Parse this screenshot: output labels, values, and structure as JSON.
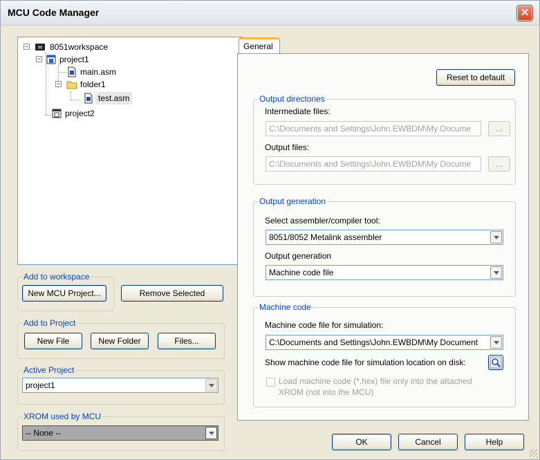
{
  "window": {
    "title": "MCU Code Manager",
    "close_icon": "close-icon"
  },
  "tree": {
    "root": "8051workspace",
    "project1": "project1",
    "main_asm": "main.asm",
    "folder1": "folder1",
    "test_asm": "test.asm",
    "project2": "project2",
    "expand_minus": "−"
  },
  "add_to_workspace": {
    "legend": "Add to workspace",
    "new_mcu_project": "New MCU Project...",
    "remove_selected": "Remove Selected"
  },
  "add_to_project": {
    "legend": "Add to Project",
    "new_file": "New File",
    "new_folder": "New Folder",
    "files": "Files..."
  },
  "active_project": {
    "legend": "Active Project",
    "value": "project1"
  },
  "xrom": {
    "legend": "XROM used by MCU",
    "value": "-- None --"
  },
  "tabs": {
    "general": "General"
  },
  "general": {
    "reset_default": "Reset to default",
    "output_directories": {
      "legend": "Output directories",
      "intermediate_label": "Intermediate files:",
      "intermediate_value": "C:\\Documents and Settings\\John.EWBDM\\My Docume",
      "output_label": "Output files:",
      "output_value": "C:\\Documents and Settings\\John.EWBDM\\My Docume",
      "browse": "..."
    },
    "output_generation": {
      "legend": "Output generation",
      "tool_label": "Select assembler/compiler tool:",
      "tool_value": "8051/8052 Metalink assembler",
      "gen_label": "Output generation",
      "gen_value": "Machine code file"
    },
    "machine_code": {
      "legend": "Machine code",
      "sim_label": "Machine code file for simulation:",
      "sim_value": "C:\\Documents and Settings\\John.EWBDM\\My Document",
      "show_label": "Show machine code file for simulation location on disk:",
      "load_label_1": "Load machine code (*.hex) file only into the attached",
      "load_label_2": "XROM (not into the MCU)"
    }
  },
  "footer": {
    "ok": "OK",
    "cancel": "Cancel",
    "help": "Help"
  },
  "colors": {
    "accent": "#0046d5",
    "face": "#ECE9D8",
    "tab_highlight": "#f5b945"
  }
}
